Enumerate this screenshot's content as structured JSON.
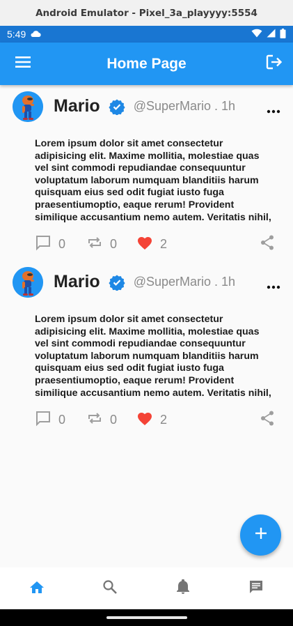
{
  "emulator": {
    "title": "Android Emulator - Pixel_3a_playyyy:5554"
  },
  "status_bar": {
    "time": "5:49",
    "icons": [
      "cloud-icon",
      "wifi-icon",
      "signal-icon",
      "battery-icon"
    ]
  },
  "app_bar": {
    "title": "Home Page",
    "left_icon": "menu-icon",
    "right_icon": "logout-icon"
  },
  "posts": [
    {
      "name": "Mario",
      "handle": "@SuperMario . 1h",
      "text": "Lorem ipsum dolor sit amet consectetur\nadipisicing elit. Maxime mollitia, molestiae quas\nvel sint commodi repudiandae consequuntur\nvoluptatum laborum numquam blanditiis harum\nquisquam eius sed odit fugiat iusto fuga\npraesentiumoptio, eaque rerum! Provident\nsimilique accusantium nemo autem. Veritatis nihil,",
      "comments": "0",
      "retweets": "0",
      "likes": "2"
    },
    {
      "name": "Mario",
      "handle": "@SuperMario . 1h",
      "text": "Lorem ipsum dolor sit amet consectetur\nadipisicing elit. Maxime mollitia, molestiae quas\nvel sint commodi repudiandae consequuntur\nvoluptatum laborum numquam blanditiis harum\nquisquam eius sed odit fugiat iusto fuga\npraesentiumoptio, eaque rerum! Provident\nsimilique accusantium nemo autem. Veritatis nihil,",
      "comments": "0",
      "retweets": "0",
      "likes": "2"
    }
  ],
  "fab": {
    "icon": "plus-icon"
  },
  "bottom_nav": {
    "items": [
      {
        "icon": "home-icon",
        "active": true
      },
      {
        "icon": "search-icon",
        "active": false
      },
      {
        "icon": "bell-icon",
        "active": false
      },
      {
        "icon": "message-icon",
        "active": false
      }
    ]
  },
  "colors": {
    "primary": "#2196f3",
    "status_bar": "#1976d2",
    "like": "#f44336",
    "icon_grey": "#9e9e9e",
    "nav_active": "#2196f3",
    "nav_inactive": "#757575"
  }
}
